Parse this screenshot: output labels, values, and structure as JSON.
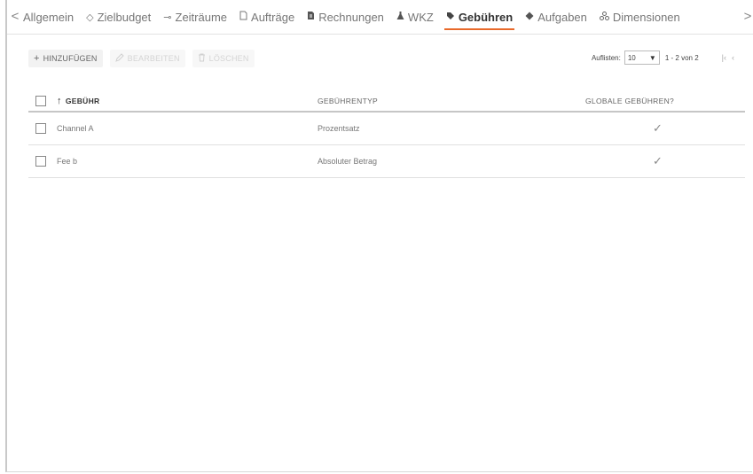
{
  "tabs": [
    {
      "label": "Allgemein",
      "icon": "cog-icon",
      "glyph": ""
    },
    {
      "label": "Zielbudget",
      "icon": "target-icon",
      "glyph": "◇"
    },
    {
      "label": "Zeiträume",
      "icon": "timeline-icon",
      "glyph": "⊸"
    },
    {
      "label": "Aufträge",
      "icon": "document-icon",
      "glyph": "▯"
    },
    {
      "label": "Rechnungen",
      "icon": "invoice-icon",
      "glyph": "▮"
    },
    {
      "label": "WKZ",
      "icon": "flask-icon",
      "glyph": "▲"
    },
    {
      "label": "Gebühren",
      "icon": "tag-icon",
      "glyph": "◆"
    },
    {
      "label": "Aufgaben",
      "icon": "task-icon",
      "glyph": "◆"
    },
    {
      "label": "Dimensionen",
      "icon": "dimensions-icon",
      "glyph": "⁂"
    }
  ],
  "active_tab": "Gebühren",
  "toolbar": {
    "add_label": "HINZUFÜGEN",
    "edit_label": "BEARBEITEN",
    "delete_label": "LÖSCHEN"
  },
  "pager": {
    "list_label": "Auflisten:",
    "page_size": "10",
    "range": "1 - 2 von 2"
  },
  "table": {
    "headers": {
      "fee": "GEBÜHR",
      "type": "GEBÜHRENTYP",
      "global": "GLOBALE GEBÜHREN?"
    },
    "rows": [
      {
        "fee": "Channel A",
        "type": "Prozentsatz",
        "global": true
      },
      {
        "fee": "Fee b",
        "type": "Absoluter Betrag",
        "global": true
      }
    ]
  },
  "colors": {
    "accent": "#e8692a"
  }
}
